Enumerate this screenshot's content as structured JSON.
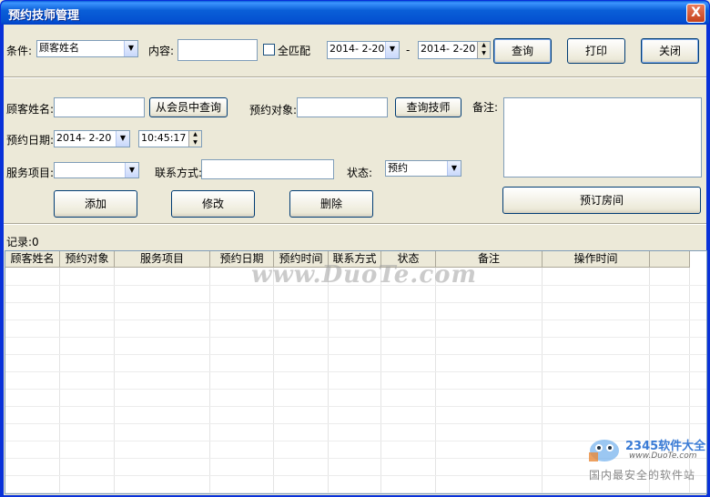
{
  "window": {
    "title": "预约技师管理",
    "close_glyph": "X"
  },
  "search": {
    "condition_label": "条件:",
    "condition_value": "顾客姓名",
    "content_label": "内容:",
    "content_value": "",
    "full_match_label": "全匹配",
    "full_match_checked": false,
    "date_from": "2014- 2-20",
    "dash": "-",
    "date_to": "2014- 2-20",
    "query_button": "查询",
    "print_button": "打印",
    "close_button": "关闭"
  },
  "form": {
    "customer_name_label": "顾客姓名:",
    "customer_name_value": "",
    "member_query_button": "从会员中查询",
    "target_label": "预约对象:",
    "target_value": "",
    "query_tech_button": "查询技师",
    "remark_label": "备注:",
    "remark_value": "",
    "date_label": "预约日期:",
    "date_value": "2014- 2-20",
    "time_value": "10:45:17",
    "service_label": "服务项目:",
    "service_value": "",
    "contact_label": "联系方式:",
    "contact_value": "",
    "status_label": "状态:",
    "status_value": "预约",
    "add_button": "添加",
    "modify_button": "修改",
    "delete_button": "删除",
    "book_room_button": "预订房间"
  },
  "records": {
    "label": "记录:0"
  },
  "table": {
    "columns": [
      "顾客姓名",
      "预约对象",
      "服务项目",
      "预约日期",
      "预约时间",
      "联系方式",
      "状态",
      "备注",
      "操作时间"
    ],
    "rows": []
  },
  "watermark": {
    "text": "www.DuoTe.com"
  },
  "corner_logo": {
    "brand": "2345软件大全",
    "url": "www.DuoTe.com",
    "slogan": "国内最安全的软件站"
  },
  "icons": {
    "dropdown": "chevron-down-icon",
    "spin": "spinner-icon",
    "close": "close-icon"
  }
}
